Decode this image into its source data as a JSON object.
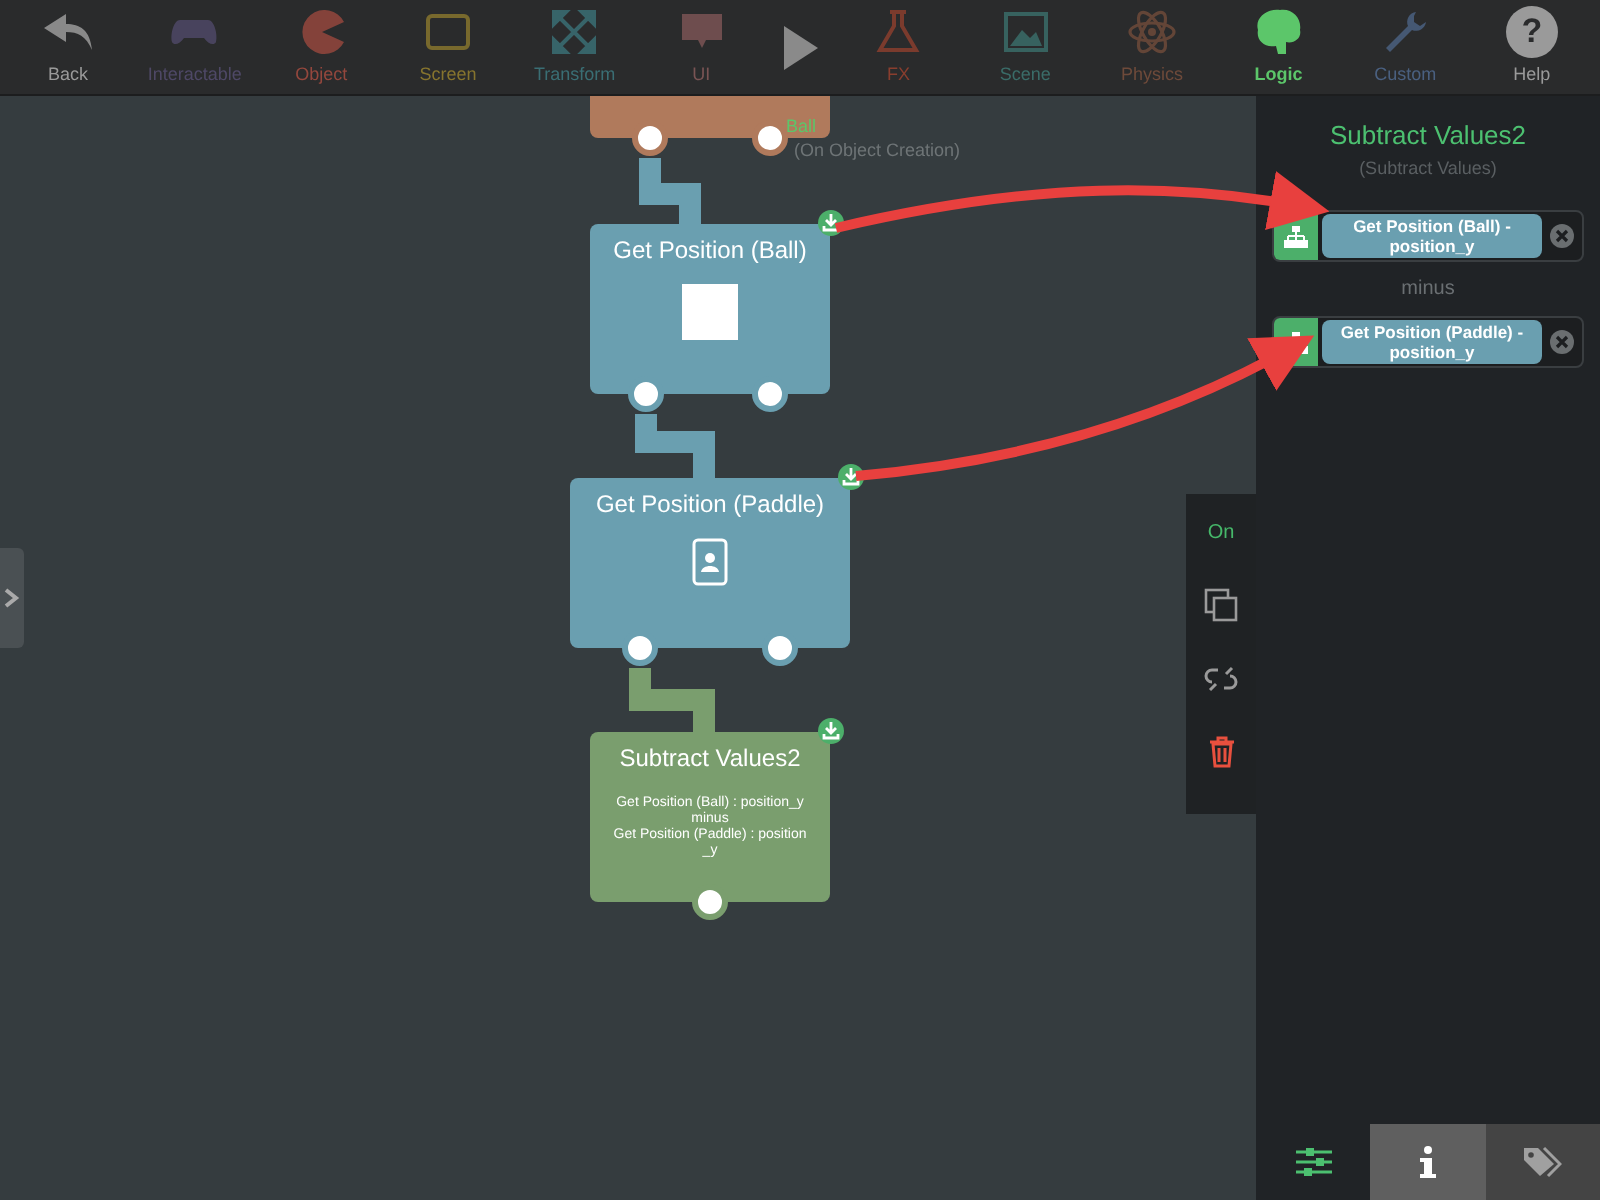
{
  "toolbar": {
    "items": [
      {
        "label": "Back",
        "color": "#9a9a9a",
        "selected": false
      },
      {
        "label": "Interactable",
        "color": "#4e4866",
        "selected": false
      },
      {
        "label": "Object",
        "color": "#94473d",
        "selected": false
      },
      {
        "label": "Screen",
        "color": "#86742e",
        "selected": false
      },
      {
        "label": "Transform",
        "color": "#3a6e74",
        "selected": false
      },
      {
        "label": "UI",
        "color": "#7a5454",
        "selected": false
      },
      {
        "kind": "play"
      },
      {
        "label": "FX",
        "color": "#8a3e2e",
        "selected": false
      },
      {
        "label": "Scene",
        "color": "#3a6c68",
        "selected": false
      },
      {
        "label": "Physics",
        "color": "#6e4a3a",
        "selected": false
      },
      {
        "label": "Logic",
        "color": "#5cc66a",
        "selected": true
      },
      {
        "label": "Custom",
        "color": "#4a6080",
        "selected": false
      },
      {
        "label": "Help",
        "color": "#9a9a9a",
        "selected": false,
        "glyph": "?"
      }
    ]
  },
  "canvas": {
    "nodes": [
      {
        "kind": "event",
        "title": "Ball",
        "subtitle": "(On Object Creation)",
        "color": "#b07a5c"
      },
      {
        "kind": "block",
        "title": "Get Position (Ball)",
        "color": "#6a9fb0"
      },
      {
        "kind": "block",
        "title": "Get Position (Paddle)",
        "color": "#6a9fb0"
      },
      {
        "kind": "result",
        "title": "Subtract Values2",
        "lines": [
          "Get Position (Ball) : position_y",
          "minus",
          "Get Position (Paddle) : position_y"
        ],
        "color": "#7a9e6e"
      }
    ]
  },
  "node_actions": {
    "toggle": "On"
  },
  "inspector": {
    "title": "Subtract Values2",
    "subtitle": "(Subtract Values)",
    "params": [
      {
        "kind": "value",
        "value": "Get Position (Ball) - position_y"
      },
      {
        "kind": "operator",
        "value": "minus"
      },
      {
        "kind": "value",
        "value": "Get Position (Paddle) - position_y"
      }
    ],
    "tabs": [
      {
        "selected": false
      },
      {
        "selected": true
      },
      {
        "selected": false
      }
    ]
  }
}
